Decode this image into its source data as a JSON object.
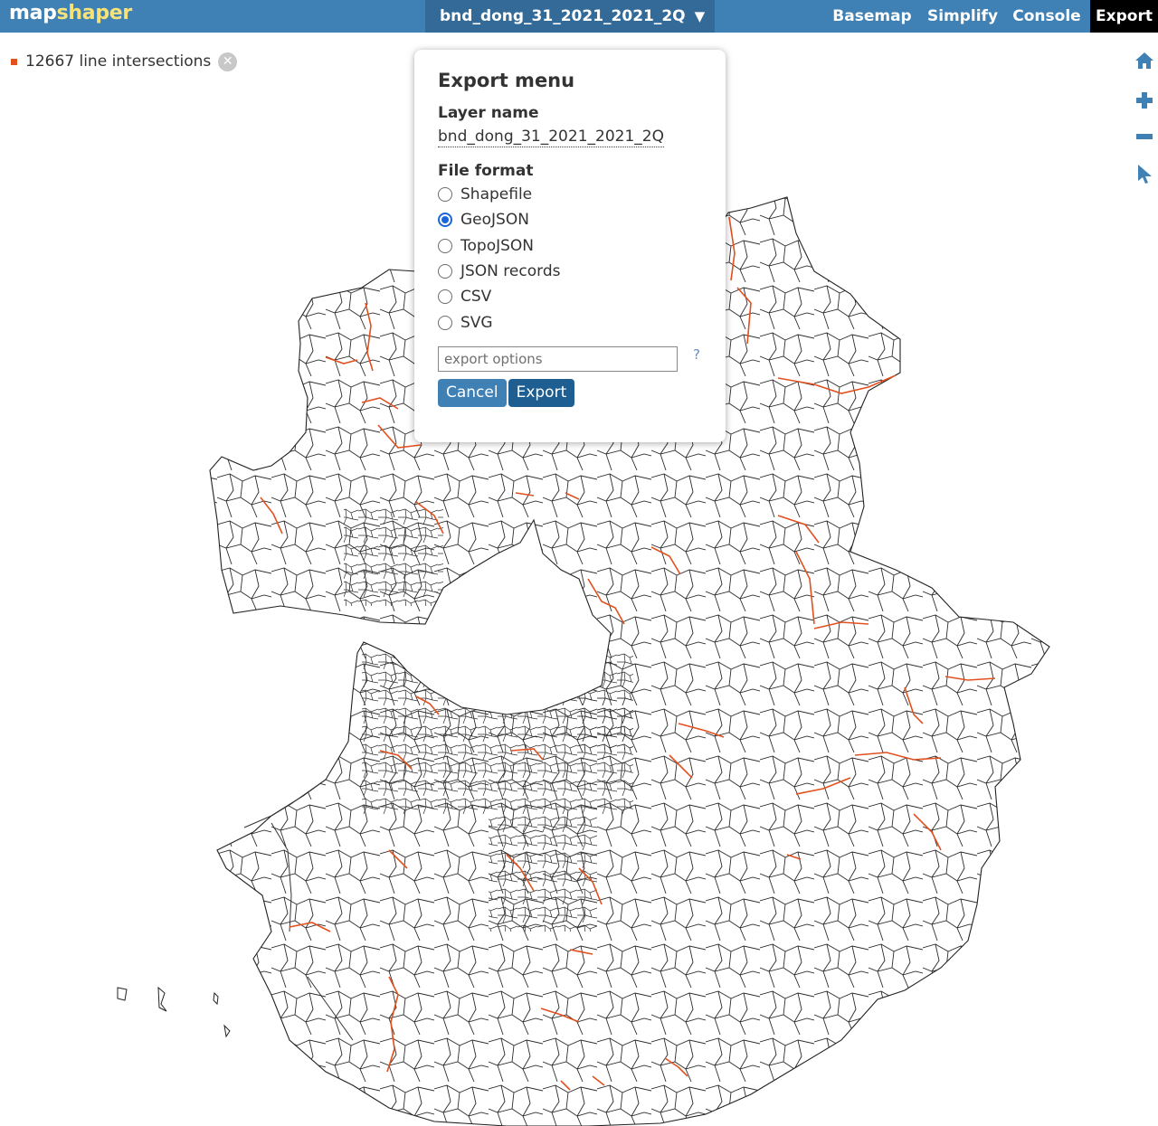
{
  "app": {
    "logo_part1": "map",
    "logo_part2": "shaper"
  },
  "header": {
    "layer_name": "bnd_dong_31_2021_2021_2Q",
    "caret": "▼",
    "nav": {
      "basemap": "Basemap",
      "simplify": "Simplify",
      "console": "Console",
      "export": "Export"
    },
    "colors": {
      "bar": "#3f80b5",
      "layer_select": "#336a98",
      "active_nav": "#000000",
      "logo_accent": "#f6e27a"
    }
  },
  "intersections": {
    "label": "12667 line intersections",
    "close_symbol": "✕",
    "color": "#e2501e"
  },
  "map_tools": [
    "home-icon",
    "zoom-in-icon",
    "zoom-out-icon",
    "pointer-icon"
  ],
  "export_menu": {
    "title": "Export menu",
    "layer_name_label": "Layer name",
    "layer_name_value": "bnd_dong_31_2021_2021_2Q",
    "file_format_label": "File format",
    "formats": [
      {
        "label": "Shapefile",
        "checked": false
      },
      {
        "label": "GeoJSON",
        "checked": true
      },
      {
        "label": "TopoJSON",
        "checked": false
      },
      {
        "label": "JSON records",
        "checked": false
      },
      {
        "label": "CSV",
        "checked": false
      },
      {
        "label": "SVG",
        "checked": false
      }
    ],
    "options_placeholder": "export options",
    "help_label": "?",
    "cancel_label": "Cancel",
    "export_label": "Export"
  },
  "map": {
    "line_color": "#333333",
    "intersection_color": "#e2501e"
  }
}
